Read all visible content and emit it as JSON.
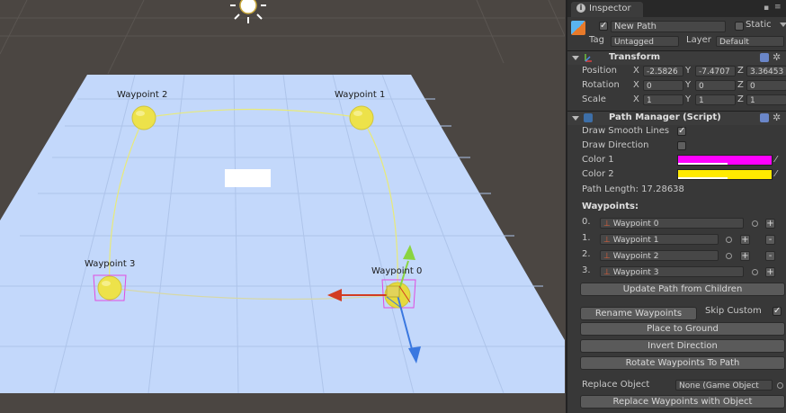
{
  "scene": {
    "waypoint_labels": [
      "Waypoint 2",
      "Waypoint 1",
      "Waypoint 3",
      "Waypoint 0"
    ]
  },
  "inspector": {
    "tab": "Inspector",
    "object_name": "New Path",
    "static_label": "Static",
    "tag_label": "Tag",
    "tag_value": "Untagged",
    "layer_label": "Layer",
    "layer_value": "Default",
    "transform": {
      "title": "Transform",
      "position_label": "Position",
      "rotation_label": "Rotation",
      "scale_label": "Scale",
      "x": "X",
      "y": "Y",
      "z": "Z",
      "position": [
        "-2.5826",
        "-7.4707",
        "3.36453"
      ],
      "rotation": [
        "0",
        "0",
        "0"
      ],
      "scale": [
        "1",
        "1",
        "1"
      ]
    },
    "path_manager": {
      "title": "Path Manager (Script)",
      "draw_smooth_lines": "Draw Smooth Lines",
      "draw_direction": "Draw Direction",
      "color1_label": "Color 1",
      "color2_label": "Color 2",
      "color1": "#ff00ff",
      "color2": "#ffea00",
      "path_length": "Path Length: 17.28638",
      "waypoints_header": "Waypoints:",
      "waypoints": [
        {
          "index": "0.",
          "name": "Waypoint 0"
        },
        {
          "index": "1.",
          "name": "Waypoint 1"
        },
        {
          "index": "2.",
          "name": "Waypoint 2"
        },
        {
          "index": "3.",
          "name": "Waypoint 3"
        }
      ],
      "update_path": "Update Path from Children",
      "rename_waypoints": "Rename Waypoints",
      "skip_custom": "Skip Custom",
      "place_to_ground": "Place to Ground",
      "invert_direction": "Invert Direction",
      "rotate_waypoints": "Rotate Waypoints To Path",
      "replace_object_label": "Replace Object",
      "replace_object_value": "None (Game Object",
      "replace_waypoints": "Replace Waypoints with Object"
    }
  }
}
